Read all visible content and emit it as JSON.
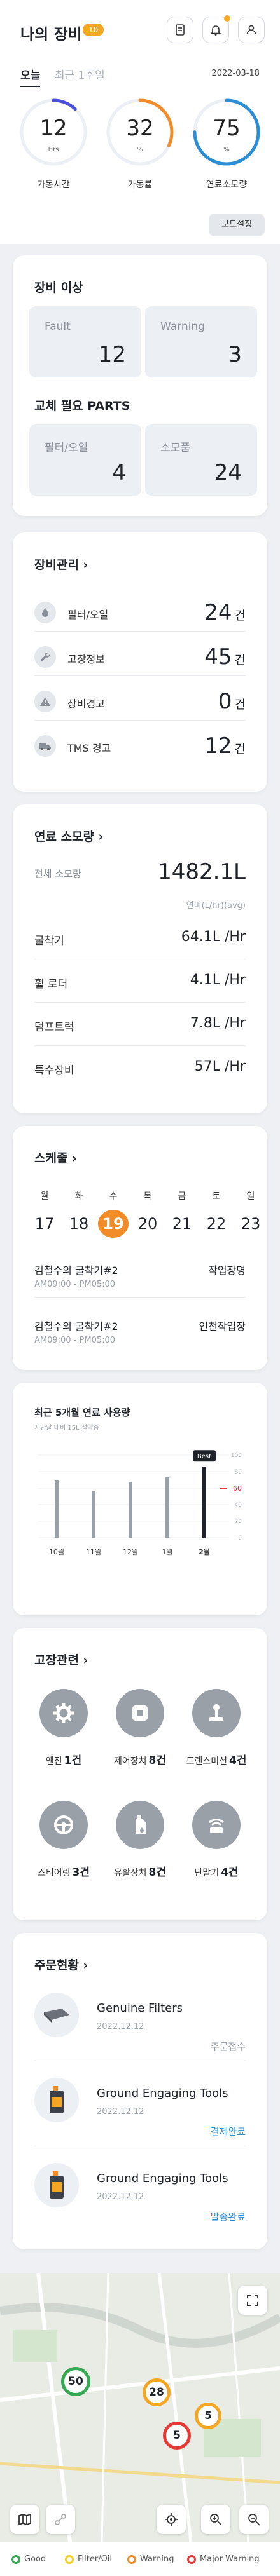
{
  "header": {
    "title": "나의 장비",
    "badge": "10"
  },
  "tabs": {
    "today": "오늘",
    "recent": "최근 1주일",
    "date": "2022-03-18"
  },
  "gauges": [
    {
      "value": "12",
      "unit": "Hrs",
      "label": "가동시간",
      "percent": 12,
      "color": "#4a4fd8"
    },
    {
      "value": "32",
      "unit": "%",
      "label": "가동률",
      "percent": 32,
      "color": "#f28c28"
    },
    {
      "value": "75",
      "unit": "%",
      "label": "연료소모량",
      "percent": 75,
      "color": "#2b8fd6"
    }
  ],
  "board_button": "보드설정",
  "equipment_issue": {
    "title": "장비 이상",
    "fault_label": "Fault",
    "fault_value": "12",
    "warning_label": "Warning",
    "warning_value": "3"
  },
  "parts": {
    "title": "교체 필요 PARTS",
    "filter_label": "필터/오일",
    "filter_value": "4",
    "consumable_label": "소모품",
    "consumable_value": "24"
  },
  "management": {
    "title": "장비관리",
    "rows": [
      {
        "label": "필터/오일",
        "value": "24",
        "unit": "건",
        "icon": "oil-drop-icon"
      },
      {
        "label": "고장정보",
        "value": "45",
        "unit": "건",
        "icon": "wrench-icon"
      },
      {
        "label": "장비경고",
        "value": "0",
        "unit": "건",
        "icon": "warning-icon"
      },
      {
        "label": "TMS 경고",
        "value": "12",
        "unit": "건",
        "icon": "truck-icon"
      }
    ]
  },
  "fuel": {
    "title": "연료 소모량",
    "total_label": "전체 소모량",
    "total_value": "1482.1L",
    "sub": "연비(L/hr)(avg)",
    "rows": [
      {
        "label": "굴착기",
        "value": "64.1L /Hr"
      },
      {
        "label": "휠 로더",
        "value": "4.1L /Hr"
      },
      {
        "label": "덤프트럭",
        "value": "7.8L /Hr"
      },
      {
        "label": "특수장비",
        "value": "57L /Hr"
      }
    ]
  },
  "schedule": {
    "title": "스케줄",
    "days": [
      {
        "name": "월",
        "date": "17"
      },
      {
        "name": "화",
        "date": "18"
      },
      {
        "name": "수",
        "date": "19",
        "selected": true
      },
      {
        "name": "목",
        "date": "20"
      },
      {
        "name": "금",
        "date": "21"
      },
      {
        "name": "토",
        "date": "22"
      },
      {
        "name": "일",
        "date": "23"
      }
    ],
    "items": [
      {
        "name": "김철수의 굴착기#2",
        "time": "AM09:00 - PM05:00",
        "place": "작업장명"
      },
      {
        "name": "김철수의 굴착기#2",
        "time": "AM09:00 - PM05:00",
        "place": "인천작업장"
      }
    ]
  },
  "fuel_chart": {
    "title": "최근 5개월 연료 사용량",
    "subtitle": "지난달 대비 15L 절약중",
    "best_label": "Best",
    "marker": "60"
  },
  "chart_data": {
    "type": "bar",
    "categories": [
      "10월",
      "11월",
      "12월",
      "1월",
      "2월"
    ],
    "values": [
      70,
      57,
      67,
      73,
      86
    ],
    "ylim": [
      0,
      100
    ],
    "yticks": [
      "0",
      "20",
      "40",
      "60",
      "80",
      "100"
    ],
    "highlight_index": 4,
    "reference_line": 60
  },
  "faults": {
    "title": "고장관련",
    "items": [
      {
        "label": "엔진",
        "value": "1건",
        "icon": "engine-gear-icon"
      },
      {
        "label": "제어장치",
        "value": "8건",
        "icon": "control-unit-icon"
      },
      {
        "label": "트랜스미션",
        "value": "4건",
        "icon": "transmission-icon"
      },
      {
        "label": "스티어링",
        "value": "3건",
        "icon": "steering-wheel-icon"
      },
      {
        "label": "유활장치",
        "value": "8건",
        "icon": "lubrication-icon"
      },
      {
        "label": "단말기",
        "value": "4건",
        "icon": "terminal-signal-icon"
      }
    ]
  },
  "orders": {
    "title": "주문현황",
    "items": [
      {
        "name": "Genuine Filters",
        "date": "2022.12.12",
        "status": "주문접수",
        "status_color": "#9aa0a8"
      },
      {
        "name": "Ground Engaging Tools",
        "date": "2022.12.12",
        "status": "결제완료",
        "status_color": "#2b8fd6"
      },
      {
        "name": "Ground Engaging Tools",
        "date": "2022.12.12",
        "status": "발송완료",
        "status_color": "#2b8fd6"
      }
    ]
  },
  "map": {
    "clusters": [
      {
        "count": "50",
        "color": "#36a853"
      },
      {
        "count": "28",
        "color": "#f5a623"
      },
      {
        "count": "5",
        "color": "#f5a623"
      },
      {
        "count": "5",
        "color": "#e53935"
      }
    ],
    "legend": [
      {
        "label": "Good",
        "color": "#36a853"
      },
      {
        "label": "Filter/Oil",
        "color": "#f5d223"
      },
      {
        "label": "Warning",
        "color": "#f28c28"
      },
      {
        "label": "Major Warning",
        "color": "#e53935"
      }
    ]
  }
}
